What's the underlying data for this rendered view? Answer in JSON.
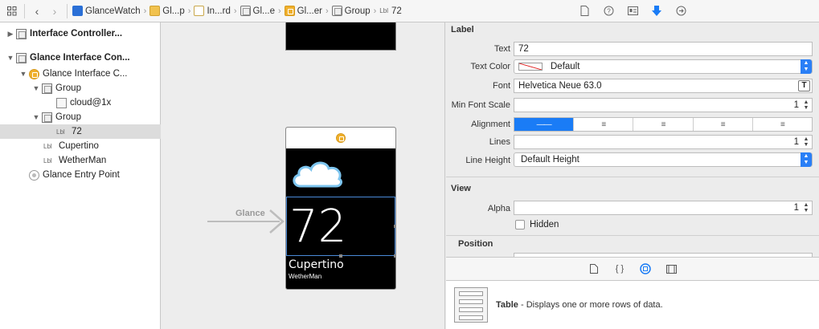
{
  "jumpbar": {
    "crumbs": [
      "GlanceWatch",
      "Gl...p",
      "In...rd",
      "Gl...e",
      "Gl...er",
      "Group",
      "72"
    ],
    "lbl_prefix": "Lbl"
  },
  "outline": {
    "items": [
      {
        "label": "Interface Controller..."
      },
      {
        "label": "Glance Interface Con..."
      },
      {
        "label": "Glance Interface C..."
      },
      {
        "label": "Group"
      },
      {
        "label": "cloud@1x"
      },
      {
        "label": "Group"
      },
      {
        "label": "72",
        "prefix": "Lbl"
      },
      {
        "label": "Cupertino",
        "prefix": "Lbl"
      },
      {
        "label": "WetherMan",
        "prefix": "Lbl"
      },
      {
        "label": "Glance Entry Point"
      }
    ]
  },
  "canvas": {
    "glance_label": "Glance",
    "big_number": "72",
    "city": "Cupertino",
    "app_name": "WetherMan"
  },
  "inspector": {
    "label_section": "Label",
    "text_label": "Text",
    "text_value": "72",
    "text_color_label": "Text Color",
    "text_color_value": "Default",
    "font_label": "Font",
    "font_value": "Helvetica Neue 63.0",
    "min_font_scale_label": "Min Font Scale",
    "min_font_scale_value": "1",
    "alignment_label": "Alignment",
    "lines_label": "Lines",
    "lines_value": "1",
    "line_height_label": "Line Height",
    "line_height_value": "Default Height",
    "view_section": "View",
    "alpha_label": "Alpha",
    "alpha_value": "1",
    "hidden_label": "Hidden",
    "position_section": "Position"
  },
  "library": {
    "item_title": "Table",
    "item_desc": " - Displays one or more rows of data."
  },
  "colors": {
    "accent": "#1a7cf6",
    "controller_icon": "#f0b02c",
    "selection_border": "#4a8ad8"
  }
}
